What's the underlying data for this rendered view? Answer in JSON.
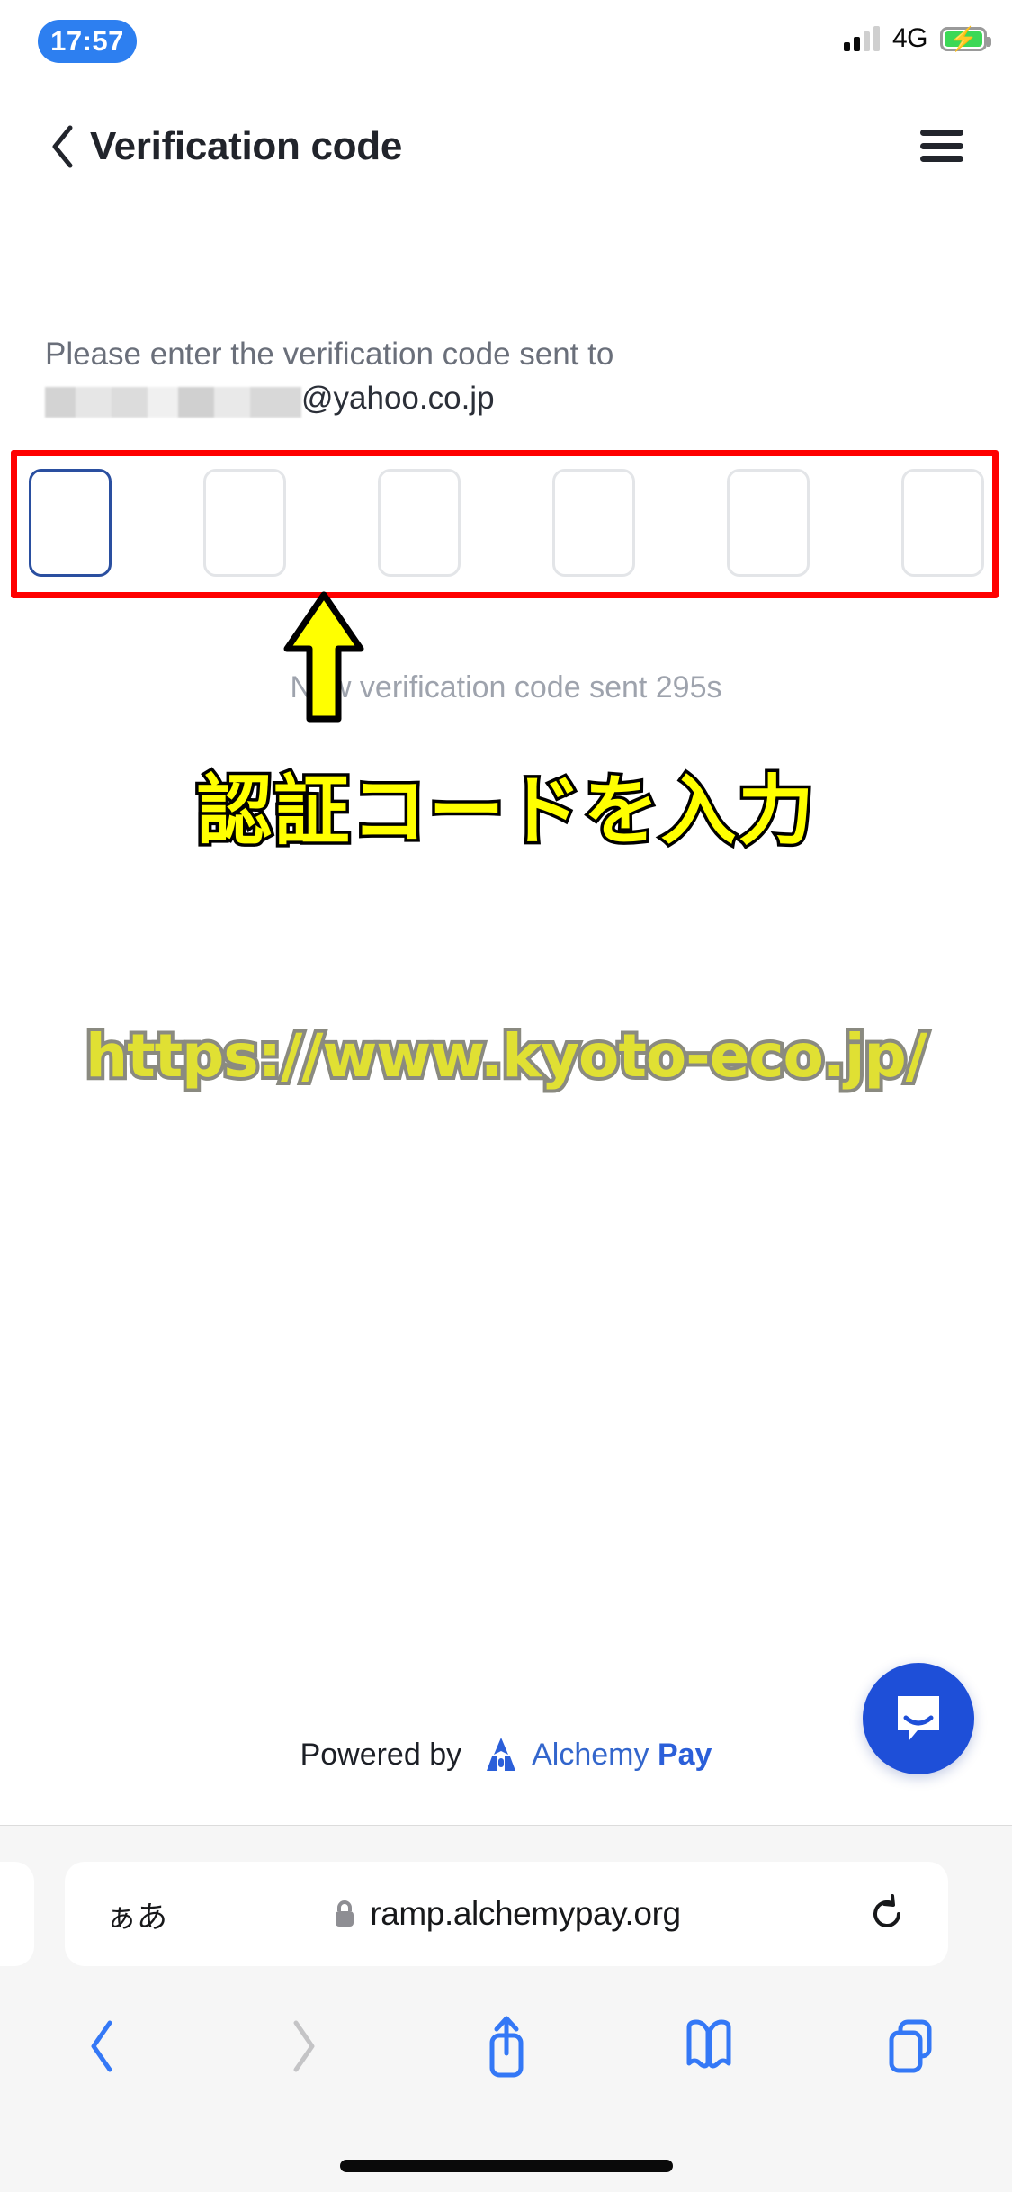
{
  "status_bar": {
    "time": "17:57",
    "network": "4G",
    "signal_bars_filled": 2,
    "signal_bars_total": 4,
    "battery_charging": true,
    "battery_color": "#3cd856",
    "time_pill_color": "#2d7ff0"
  },
  "header": {
    "back_icon": "chevron-left-icon",
    "title": "Verification code",
    "menu_icon": "hamburger-menu-icon"
  },
  "content": {
    "instruction_line1": "Please enter the verification code sent to",
    "email_redacted_placeholder": "",
    "email_domain": "@yahoo.co.jp",
    "otp": {
      "length": 6,
      "values": [
        "",
        "",
        "",
        "",
        "",
        ""
      ],
      "focused_index": 0,
      "focus_border_color": "#2a4fa0",
      "idle_border_color": "#e3e5e8"
    },
    "resend_text": "New verification code sent 295s"
  },
  "annotations": {
    "highlight_box_color": "#ff0000",
    "arrow_color": "#ffff00",
    "arrow_outline_color": "#000000",
    "japanese_caption": "認証コードを入力",
    "japanese_caption_fill": "#ffff00",
    "japanese_caption_stroke": "#000000",
    "url_watermark": "https://www.kyoto-eco.jp/",
    "url_watermark_fill": "#e0e033",
    "url_watermark_stroke": "#8a8a80"
  },
  "chat_button": {
    "icon": "chat-bubble-icon",
    "color": "#1e4fd8"
  },
  "footer": {
    "powered_by_label": "Powered by",
    "brand_icon": "alchemy-pay-rocket-icon",
    "brand_name_light": "Alchemy",
    "brand_name_bold": "Pay",
    "brand_color": "#3366cc"
  },
  "browser": {
    "text_size_button": "ぁあ",
    "lock_icon": "lock-icon",
    "url": "ramp.alchemypay.org",
    "reload_icon": "reload-icon",
    "toolbar": {
      "back_icon": "chevron-left-icon",
      "back_enabled": true,
      "forward_icon": "chevron-right-icon",
      "forward_enabled": false,
      "share_icon": "share-icon",
      "bookmarks_icon": "book-icon",
      "tabs_icon": "tabs-icon",
      "active_color": "#3478f6",
      "disabled_color": "#c4c4c6"
    }
  }
}
